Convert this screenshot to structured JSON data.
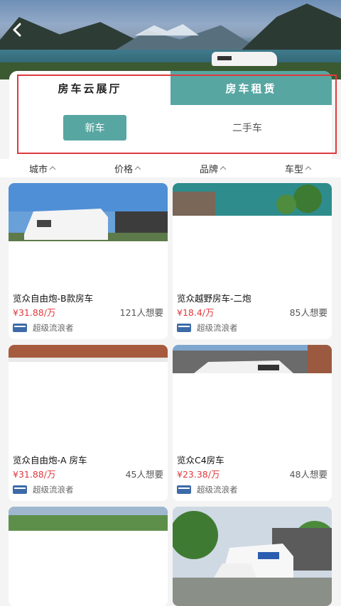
{
  "header": {
    "back_icon": "chevron-left-icon"
  },
  "tabs": [
    {
      "label": "房车云展厅",
      "active": false
    },
    {
      "label": "房车租赁",
      "active": true
    }
  ],
  "subtabs": [
    {
      "label": "新车",
      "active": true
    },
    {
      "label": "二手车",
      "active": false
    }
  ],
  "filters": [
    {
      "label": "城市",
      "icon": "caret-up-icon"
    },
    {
      "label": "价格",
      "icon": "caret-up-icon"
    },
    {
      "label": "品牌",
      "icon": "caret-up-icon"
    },
    {
      "label": "车型",
      "icon": "caret-up-icon"
    }
  ],
  "listings": [
    {
      "title": "览众自由炮-B款房车",
      "price": "¥31.88/万",
      "want": "121人想要",
      "dealer": "超级流浪者"
    },
    {
      "title": "览众越野房车-二炮",
      "price": "¥18.4/万",
      "want": "85人想要",
      "dealer": "超级流浪者"
    },
    {
      "title": "览众自由炮-A 房车",
      "price": "¥31.88/万",
      "want": "45人想要",
      "dealer": "超级流浪者"
    },
    {
      "title": "览众C4房车",
      "price": "¥23.38/万",
      "want": "48人想要",
      "dealer": "超级流浪者"
    }
  ],
  "colors": {
    "accent": "#58a6a2",
    "price_red": "#e0393d",
    "highlight_border": "#e0393d"
  }
}
